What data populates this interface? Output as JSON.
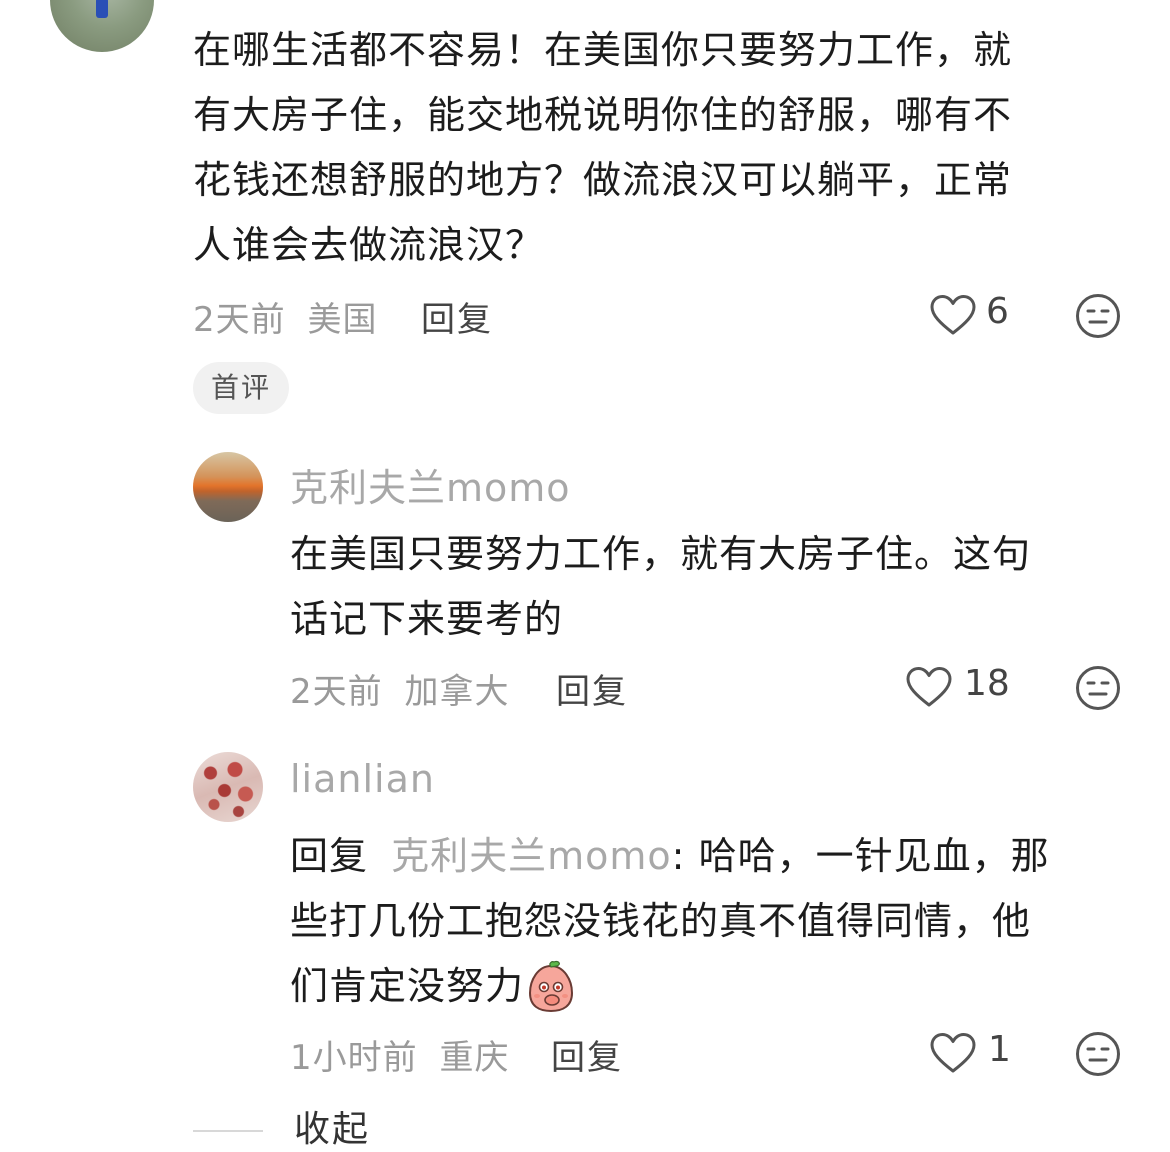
{
  "top_comment": {
    "text_lines": [
      "在哪生活都不容易！在美国你只要努力工作，就",
      "有大房子住，能交地税说明你住的舒服，哪有不",
      "花钱还想舒服的地方？做流浪汉可以躺平，正常",
      "人谁会去做流浪汉？"
    ],
    "time": "2天前",
    "location": "美国",
    "reply_label": "回复",
    "likes": "6",
    "badge": "首评"
  },
  "replies": [
    {
      "username": "克利夫兰momo",
      "text_lines": [
        "在美国只要努力工作，就有大房子住。这句",
        "话记下来要考的"
      ],
      "time": "2天前",
      "location": "加拿大",
      "reply_label": "回复",
      "likes": "18"
    },
    {
      "username": "lianlian",
      "reply_prefix": "回复",
      "reply_to": "克利夫兰momo",
      "colon": ":",
      "text_lines": [
        "哈哈，一针见血，那",
        "些打几份工抱怨没钱花的真不值得同情，他",
        "们肯定没努力"
      ],
      "time": "1小时前",
      "location": "重庆",
      "reply_label": "回复",
      "likes": "1"
    }
  ],
  "collapse_label": "收起",
  "icons": {
    "like": "heart-outline-icon",
    "dislike": "meh-face-icon",
    "emoji": "covering-mouth-emoji"
  }
}
